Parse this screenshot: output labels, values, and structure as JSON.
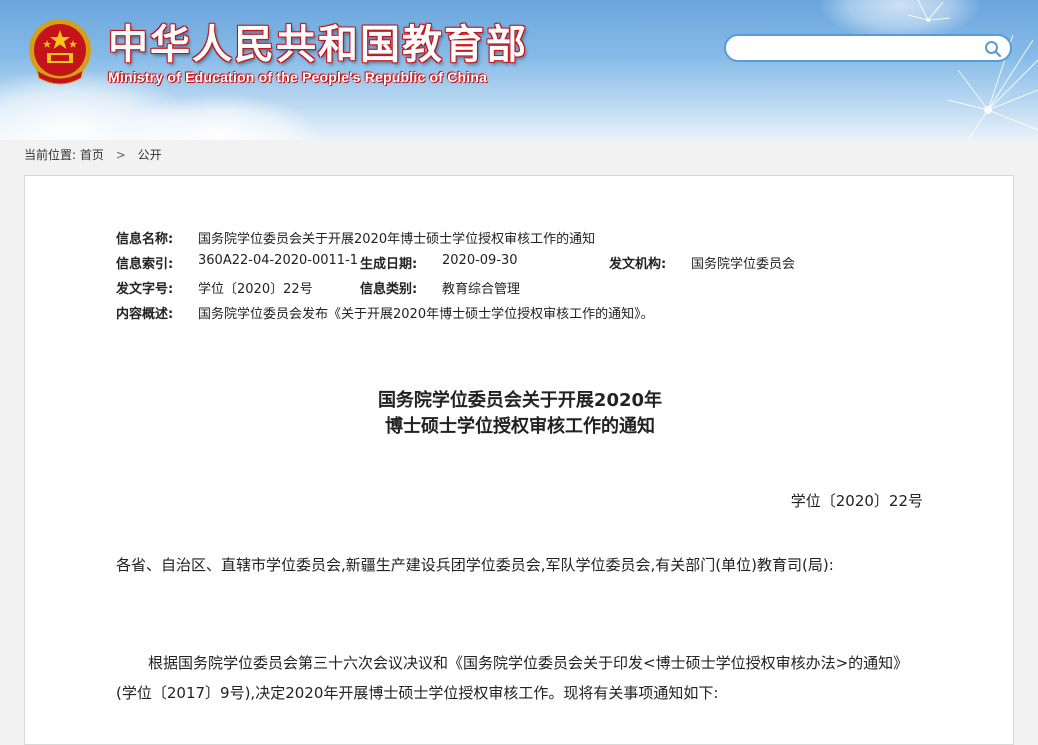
{
  "header": {
    "site_title": "中华人民共和国教育部",
    "site_subtitle": "Ministry of Education of the People's Republic of China",
    "search_placeholder": "",
    "accent_color": "#c4141a"
  },
  "breadcrumb": {
    "label": "当前位置:",
    "home": "首页",
    "separator": ">",
    "current": "公开"
  },
  "meta": {
    "name_label": "信息名称:",
    "name_value": "国务院学位委员会关于开展2020年博士硕士学位授权审核工作的通知",
    "index_label": "信息索引:",
    "index_value": "360A22-04-2020-0011-1",
    "date_label": "生成日期:",
    "date_value": "2020-09-30",
    "issuer_label": "发文机构:",
    "issuer_value": "国务院学位委员会",
    "docno_label": "发文字号:",
    "docno_value": "学位〔2020〕22号",
    "category_label": "信息类别:",
    "category_value": "教育综合管理",
    "summary_label": "内容概述:",
    "summary_value": "国务院学位委员会发布《关于开展2020年博士硕士学位授权审核工作的通知》。"
  },
  "document": {
    "title_line1": "国务院学位委员会关于开展2020年",
    "title_line2": "博士硕士学位授权审核工作的通知",
    "number": "学位〔2020〕22号",
    "paragraph1": "各省、自治区、直辖市学位委员会,新疆生产建设兵团学位委员会,军队学位委员会,有关部门(单位)教育司(局):",
    "paragraph2": "根据国务院学位委员会第三十六次会议决议和《国务院学位委员会关于印发<博士硕士学位授权审核办法>的通知》(学位〔2017〕9号),决定2020年开展博士硕士学位授权审核工作。现将有关事项通知如下:"
  }
}
